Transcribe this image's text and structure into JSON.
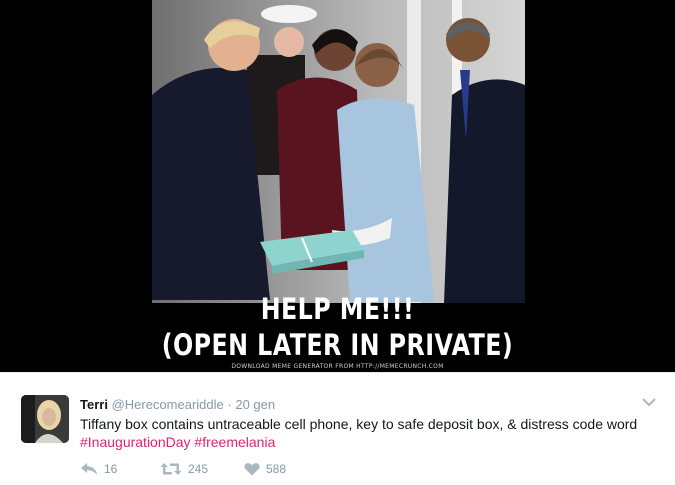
{
  "media": {
    "caption_line1": "HELP ME!!!",
    "caption_line2": "(OPEN LATER IN PRIVATE)",
    "credit": "DOWNLOAD MEME GENERATOR FROM HTTP://MEMECRUNCH.COM"
  },
  "tweet": {
    "name": "Terri",
    "handle": "@Herecomeariddle",
    "separator": "·",
    "time": "20 gen",
    "text": "Tiffany box contains untraceable cell phone, key to safe deposit box, & distress code word",
    "hashtags": [
      "#InaugurationDay",
      "#freemelania"
    ],
    "actions": {
      "reply": {
        "icon": "reply-icon",
        "count": "16"
      },
      "retweet": {
        "icon": "retweet-icon",
        "count": "245"
      },
      "like": {
        "icon": "heart-icon",
        "count": "588"
      }
    }
  },
  "colors": {
    "hashtag": "#e0246f",
    "secondary_text": "#8899a6",
    "tiffany_blue": "#8fd3cf"
  }
}
